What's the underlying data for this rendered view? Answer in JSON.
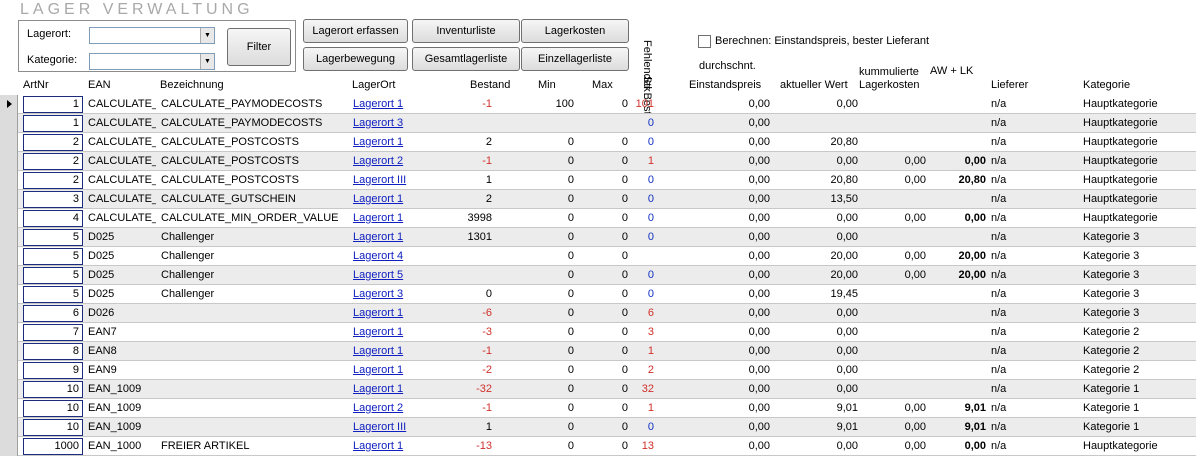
{
  "title": "LAGER VERWALTUNG",
  "filter": {
    "lagerort_label": "Lagerort:",
    "kategorie_label": "Kategorie:",
    "lagerort_value": "",
    "kategorie_value": "",
    "button": "Filter"
  },
  "buttons": {
    "lagerort_erfassen": "Lagerort erfassen",
    "inventurliste": "Inventurliste",
    "lagerkosten": "Lagerkosten",
    "lagerbewegung": "Lagerbewegung",
    "gesamtlagerliste": "Gesamtlagerliste",
    "einzellagerliste": "Einzellagerliste"
  },
  "checkbox": {
    "label": "Berechnen: Einstandspreis, bester Lieferant",
    "checked": false
  },
  "columns": {
    "artnr": "ArtNr",
    "ean": "EAN",
    "bezeichnung": "Bezeichnung",
    "lagerort": "LagerOrt",
    "bestand": "Bestand",
    "min": "Min",
    "max": "Max",
    "fehlender_bestand": "Fehlender Bestand",
    "stk": "Stk",
    "einstandspreis_top": "durchschnt.",
    "einstandspreis": "Einstandspreis",
    "aktueller_wert": "aktueller Wert",
    "kumm_top": "kummulierte",
    "kumm": "Lagerkosten",
    "aw_lk": "AW + LK",
    "lieferer": "Lieferer",
    "kategorie": "Kategorie"
  },
  "rows": [
    {
      "artnr": "1",
      "ean": "CALCULATE_",
      "bez": "CALCULATE_PAYMODECOSTS",
      "lagerort": "Lagerort 1",
      "bestand": "-1",
      "min": "100",
      "max": "0",
      "fehl": "101",
      "ep": "0,00",
      "wert": "0,00",
      "kumm": "",
      "awlk": "",
      "lieferer": "n/a",
      "kategorie": "Hauptkategorie"
    },
    {
      "artnr": "1",
      "ean": "CALCULATE_",
      "bez": "CALCULATE_PAYMODECOSTS",
      "lagerort": "Lagerort 3",
      "bestand": "",
      "min": "",
      "max": "",
      "fehl": "0",
      "ep": "0,00",
      "wert": "",
      "kumm": "",
      "awlk": "",
      "lieferer": "n/a",
      "kategorie": "Hauptkategorie"
    },
    {
      "artnr": "2",
      "ean": "CALCULATE_",
      "bez": "CALCULATE_POSTCOSTS",
      "lagerort": "Lagerort 1",
      "bestand": "2",
      "min": "0",
      "max": "0",
      "fehl": "0",
      "ep": "0,00",
      "wert": "20,80",
      "kumm": "",
      "awlk": "",
      "lieferer": "n/a",
      "kategorie": "Hauptkategorie"
    },
    {
      "artnr": "2",
      "ean": "CALCULATE_",
      "bez": "CALCULATE_POSTCOSTS",
      "lagerort": "Lagerort 2",
      "bestand": "-1",
      "min": "0",
      "max": "0",
      "fehl": "1",
      "ep": "0,00",
      "wert": "0,00",
      "kumm": "0,00",
      "awlk": "0,00",
      "lieferer": "n/a",
      "kategorie": "Hauptkategorie"
    },
    {
      "artnr": "2",
      "ean": "CALCULATE_",
      "bez": "CALCULATE_POSTCOSTS",
      "lagerort": "Lagerort III",
      "bestand": "1",
      "min": "0",
      "max": "0",
      "fehl": "0",
      "ep": "0,00",
      "wert": "20,80",
      "kumm": "0,00",
      "awlk": "20,80",
      "lieferer": "n/a",
      "kategorie": "Hauptkategorie"
    },
    {
      "artnr": "3",
      "ean": "CALCULATE_",
      "bez": "CALCULATE_GUTSCHEIN",
      "lagerort": "Lagerort 1",
      "bestand": "2",
      "min": "0",
      "max": "0",
      "fehl": "0",
      "ep": "0,00",
      "wert": "13,50",
      "kumm": "",
      "awlk": "",
      "lieferer": "n/a",
      "kategorie": "Hauptkategorie"
    },
    {
      "artnr": "4",
      "ean": "CALCULATE_",
      "bez": "CALCULATE_MIN_ORDER_VALUE",
      "lagerort": "Lagerort 1",
      "bestand": "3998",
      "min": "0",
      "max": "0",
      "fehl": "0",
      "ep": "0,00",
      "wert": "0,00",
      "kumm": "0,00",
      "awlk": "0,00",
      "lieferer": "n/a",
      "kategorie": "Hauptkategorie"
    },
    {
      "artnr": "5",
      "ean": "D025",
      "bez": "Challenger",
      "lagerort": "Lagerort 1",
      "bestand": "1301",
      "min": "0",
      "max": "0",
      "fehl": "0",
      "ep": "0,00",
      "wert": "0,00",
      "kumm": "",
      "awlk": "",
      "lieferer": "n/a",
      "kategorie": "Kategorie 3"
    },
    {
      "artnr": "5",
      "ean": "D025",
      "bez": "Challenger",
      "lagerort": "Lagerort 4",
      "bestand": "",
      "min": "0",
      "max": "0",
      "fehl": "",
      "ep": "0,00",
      "wert": "20,00",
      "kumm": "0,00",
      "awlk": "20,00",
      "lieferer": "n/a",
      "kategorie": "Kategorie 3"
    },
    {
      "artnr": "5",
      "ean": "D025",
      "bez": "Challenger",
      "lagerort": "Lagerort 5",
      "bestand": "",
      "min": "0",
      "max": "0",
      "fehl": "0",
      "ep": "0,00",
      "wert": "20,00",
      "kumm": "0,00",
      "awlk": "20,00",
      "lieferer": "n/a",
      "kategorie": "Kategorie 3"
    },
    {
      "artnr": "5",
      "ean": "D025",
      "bez": "Challenger",
      "lagerort": "Lagerort 3",
      "bestand": "0",
      "min": "0",
      "max": "0",
      "fehl": "0",
      "ep": "0,00",
      "wert": "19,45",
      "kumm": "",
      "awlk": "",
      "lieferer": "n/a",
      "kategorie": "Kategorie 3"
    },
    {
      "artnr": "6",
      "ean": "D026",
      "bez": "",
      "lagerort": "Lagerort 1",
      "bestand": "-6",
      "min": "0",
      "max": "0",
      "fehl": "6",
      "ep": "0,00",
      "wert": "0,00",
      "kumm": "",
      "awlk": "",
      "lieferer": "n/a",
      "kategorie": "Kategorie 3"
    },
    {
      "artnr": "7",
      "ean": "EAN7",
      "bez": "",
      "lagerort": "Lagerort 1",
      "bestand": "-3",
      "min": "0",
      "max": "0",
      "fehl": "3",
      "ep": "0,00",
      "wert": "0,00",
      "kumm": "",
      "awlk": "",
      "lieferer": "n/a",
      "kategorie": "Kategorie 2"
    },
    {
      "artnr": "8",
      "ean": "EAN8",
      "bez": "",
      "lagerort": "Lagerort 1",
      "bestand": "-1",
      "min": "0",
      "max": "0",
      "fehl": "1",
      "ep": "0,00",
      "wert": "0,00",
      "kumm": "",
      "awlk": "",
      "lieferer": "n/a",
      "kategorie": "Kategorie 2"
    },
    {
      "artnr": "9",
      "ean": "EAN9",
      "bez": "",
      "lagerort": "Lagerort 1",
      "bestand": "-2",
      "min": "0",
      "max": "0",
      "fehl": "2",
      "ep": "0,00",
      "wert": "0,00",
      "kumm": "",
      "awlk": "",
      "lieferer": "n/a",
      "kategorie": "Kategorie 2"
    },
    {
      "artnr": "10",
      "ean": "EAN_1009",
      "bez": "",
      "lagerort": "Lagerort 1",
      "bestand": "-32",
      "min": "0",
      "max": "0",
      "fehl": "32",
      "ep": "0,00",
      "wert": "0,00",
      "kumm": "",
      "awlk": "",
      "lieferer": "n/a",
      "kategorie": "Kategorie 1"
    },
    {
      "artnr": "10",
      "ean": "EAN_1009",
      "bez": "",
      "lagerort": "Lagerort 2",
      "bestand": "-1",
      "min": "0",
      "max": "0",
      "fehl": "1",
      "ep": "0,00",
      "wert": "9,01",
      "kumm": "0,00",
      "awlk": "9,01",
      "lieferer": "n/a",
      "kategorie": "Kategorie 1"
    },
    {
      "artnr": "10",
      "ean": "EAN_1009",
      "bez": "",
      "lagerort": "Lagerort III",
      "bestand": "1",
      "min": "0",
      "max": "0",
      "fehl": "0",
      "ep": "0,00",
      "wert": "9,01",
      "kumm": "0,00",
      "awlk": "9,01",
      "lieferer": "n/a",
      "kategorie": "Kategorie 1"
    },
    {
      "artnr": "1000",
      "ean": "EAN_1000",
      "bez": "FREIER ARTIKEL",
      "lagerort": "Lagerort 1",
      "bestand": "-13",
      "min": "0",
      "max": "0",
      "fehl": "13",
      "ep": "0,00",
      "wert": "0,00",
      "kumm": "0,00",
      "awlk": "0,00",
      "lieferer": "n/a",
      "kategorie": "Hauptkategorie"
    }
  ]
}
